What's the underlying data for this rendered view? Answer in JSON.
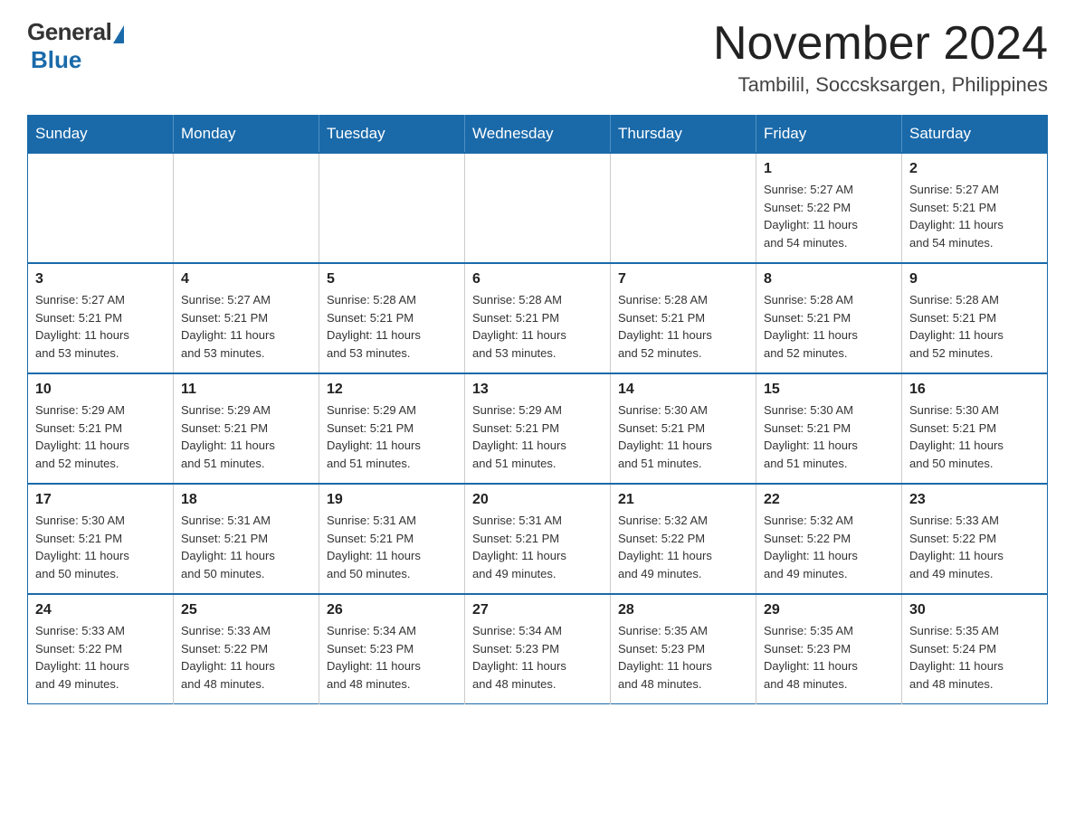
{
  "logo": {
    "general": "General",
    "blue": "Blue"
  },
  "title": "November 2024",
  "subtitle": "Tambilil, Soccsksargen, Philippines",
  "weekdays": [
    "Sunday",
    "Monday",
    "Tuesday",
    "Wednesday",
    "Thursday",
    "Friday",
    "Saturday"
  ],
  "weeks": [
    [
      {
        "day": "",
        "info": ""
      },
      {
        "day": "",
        "info": ""
      },
      {
        "day": "",
        "info": ""
      },
      {
        "day": "",
        "info": ""
      },
      {
        "day": "",
        "info": ""
      },
      {
        "day": "1",
        "info": "Sunrise: 5:27 AM\nSunset: 5:22 PM\nDaylight: 11 hours\nand 54 minutes."
      },
      {
        "day": "2",
        "info": "Sunrise: 5:27 AM\nSunset: 5:21 PM\nDaylight: 11 hours\nand 54 minutes."
      }
    ],
    [
      {
        "day": "3",
        "info": "Sunrise: 5:27 AM\nSunset: 5:21 PM\nDaylight: 11 hours\nand 53 minutes."
      },
      {
        "day": "4",
        "info": "Sunrise: 5:27 AM\nSunset: 5:21 PM\nDaylight: 11 hours\nand 53 minutes."
      },
      {
        "day": "5",
        "info": "Sunrise: 5:28 AM\nSunset: 5:21 PM\nDaylight: 11 hours\nand 53 minutes."
      },
      {
        "day": "6",
        "info": "Sunrise: 5:28 AM\nSunset: 5:21 PM\nDaylight: 11 hours\nand 53 minutes."
      },
      {
        "day": "7",
        "info": "Sunrise: 5:28 AM\nSunset: 5:21 PM\nDaylight: 11 hours\nand 52 minutes."
      },
      {
        "day": "8",
        "info": "Sunrise: 5:28 AM\nSunset: 5:21 PM\nDaylight: 11 hours\nand 52 minutes."
      },
      {
        "day": "9",
        "info": "Sunrise: 5:28 AM\nSunset: 5:21 PM\nDaylight: 11 hours\nand 52 minutes."
      }
    ],
    [
      {
        "day": "10",
        "info": "Sunrise: 5:29 AM\nSunset: 5:21 PM\nDaylight: 11 hours\nand 52 minutes."
      },
      {
        "day": "11",
        "info": "Sunrise: 5:29 AM\nSunset: 5:21 PM\nDaylight: 11 hours\nand 51 minutes."
      },
      {
        "day": "12",
        "info": "Sunrise: 5:29 AM\nSunset: 5:21 PM\nDaylight: 11 hours\nand 51 minutes."
      },
      {
        "day": "13",
        "info": "Sunrise: 5:29 AM\nSunset: 5:21 PM\nDaylight: 11 hours\nand 51 minutes."
      },
      {
        "day": "14",
        "info": "Sunrise: 5:30 AM\nSunset: 5:21 PM\nDaylight: 11 hours\nand 51 minutes."
      },
      {
        "day": "15",
        "info": "Sunrise: 5:30 AM\nSunset: 5:21 PM\nDaylight: 11 hours\nand 51 minutes."
      },
      {
        "day": "16",
        "info": "Sunrise: 5:30 AM\nSunset: 5:21 PM\nDaylight: 11 hours\nand 50 minutes."
      }
    ],
    [
      {
        "day": "17",
        "info": "Sunrise: 5:30 AM\nSunset: 5:21 PM\nDaylight: 11 hours\nand 50 minutes."
      },
      {
        "day": "18",
        "info": "Sunrise: 5:31 AM\nSunset: 5:21 PM\nDaylight: 11 hours\nand 50 minutes."
      },
      {
        "day": "19",
        "info": "Sunrise: 5:31 AM\nSunset: 5:21 PM\nDaylight: 11 hours\nand 50 minutes."
      },
      {
        "day": "20",
        "info": "Sunrise: 5:31 AM\nSunset: 5:21 PM\nDaylight: 11 hours\nand 49 minutes."
      },
      {
        "day": "21",
        "info": "Sunrise: 5:32 AM\nSunset: 5:22 PM\nDaylight: 11 hours\nand 49 minutes."
      },
      {
        "day": "22",
        "info": "Sunrise: 5:32 AM\nSunset: 5:22 PM\nDaylight: 11 hours\nand 49 minutes."
      },
      {
        "day": "23",
        "info": "Sunrise: 5:33 AM\nSunset: 5:22 PM\nDaylight: 11 hours\nand 49 minutes."
      }
    ],
    [
      {
        "day": "24",
        "info": "Sunrise: 5:33 AM\nSunset: 5:22 PM\nDaylight: 11 hours\nand 49 minutes."
      },
      {
        "day": "25",
        "info": "Sunrise: 5:33 AM\nSunset: 5:22 PM\nDaylight: 11 hours\nand 48 minutes."
      },
      {
        "day": "26",
        "info": "Sunrise: 5:34 AM\nSunset: 5:23 PM\nDaylight: 11 hours\nand 48 minutes."
      },
      {
        "day": "27",
        "info": "Sunrise: 5:34 AM\nSunset: 5:23 PM\nDaylight: 11 hours\nand 48 minutes."
      },
      {
        "day": "28",
        "info": "Sunrise: 5:35 AM\nSunset: 5:23 PM\nDaylight: 11 hours\nand 48 minutes."
      },
      {
        "day": "29",
        "info": "Sunrise: 5:35 AM\nSunset: 5:23 PM\nDaylight: 11 hours\nand 48 minutes."
      },
      {
        "day": "30",
        "info": "Sunrise: 5:35 AM\nSunset: 5:24 PM\nDaylight: 11 hours\nand 48 minutes."
      }
    ]
  ]
}
